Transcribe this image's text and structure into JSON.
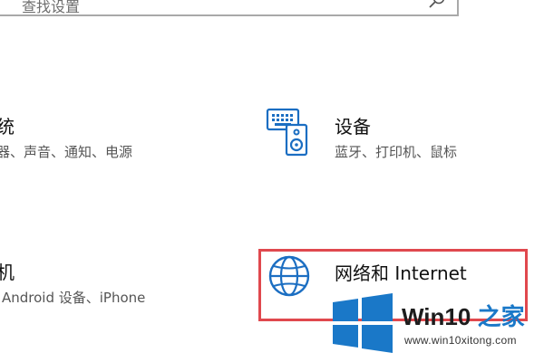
{
  "search": {
    "placeholder": "查找设置"
  },
  "tiles": {
    "system": {
      "title": "统",
      "desc": "器、声音、通知、电源"
    },
    "devices": {
      "title": "设备",
      "desc": "蓝牙、打印机、鼠标",
      "icon": "keyboard-speaker-icon"
    },
    "phone": {
      "title": "机",
      "desc": "Android 设备、iPhone"
    },
    "network": {
      "title": "网络和 Internet",
      "icon": "globe-icon"
    }
  },
  "watermark": {
    "title_main": "Win10 ",
    "title_accent": "之家",
    "url": "www.win10xitong.com",
    "logo": "windows-logo"
  },
  "colors": {
    "accent": "#1a78c8",
    "highlight": "#e0484e",
    "icon_blue": "#1b6ec2"
  }
}
